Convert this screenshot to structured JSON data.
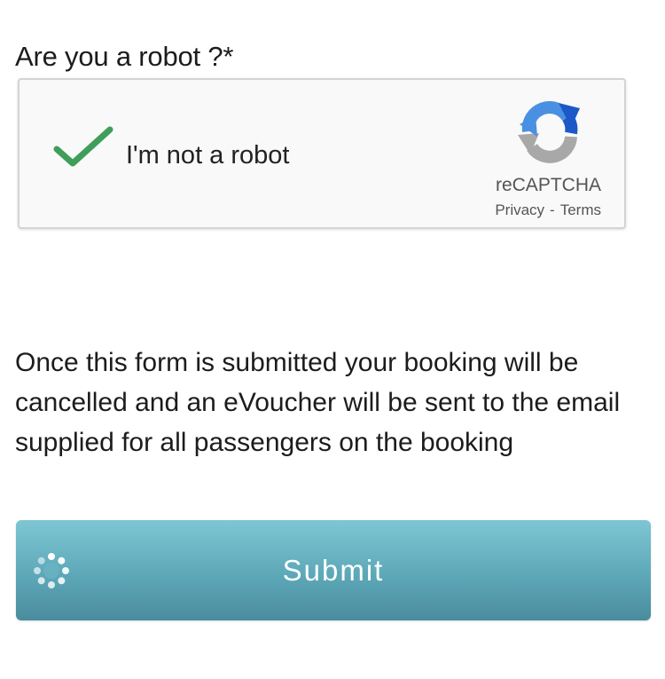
{
  "form": {
    "robot_question": "Are you a robot ?*"
  },
  "recaptcha": {
    "checkbox_label": "I'm not a robot",
    "checked": true,
    "brand": "reCAPTCHA",
    "privacy_link": "Privacy",
    "separator": "-",
    "terms_link": "Terms",
    "icons": {
      "check": "checkmark-icon",
      "logo": "recaptcha-logo-icon"
    },
    "colors": {
      "check": "#3f9e5a",
      "logo_blue": "#1c58c7",
      "logo_light_blue": "#4a90e2",
      "logo_gray": "#a8a8a8"
    }
  },
  "notice": {
    "text": "Once this form is submitted your booking will be cancelled and an eVoucher will be sent to the email supplied for all passengers on the booking"
  },
  "submit": {
    "label": "Submit",
    "icon": "spinner-icon",
    "colors": {
      "top": "#7ec6d4",
      "bottom": "#4a8c9e"
    }
  }
}
